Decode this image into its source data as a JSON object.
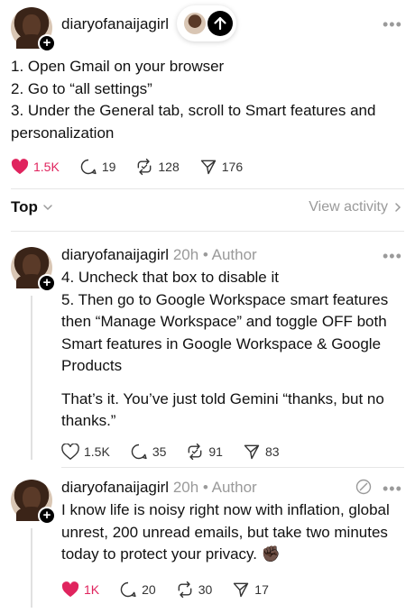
{
  "post1": {
    "username": "diaryofanaijagirl",
    "lines": [
      "1. Open Gmail on your browser",
      "2. Go to “all settings”",
      "3. Under the General tab, scroll to Smart features and personalization"
    ],
    "likes": "1.5K",
    "replies": "19",
    "reposts": "128",
    "shares": "176"
  },
  "sort": {
    "label": "Top",
    "view_activity": "View activity"
  },
  "reply1": {
    "username": "diaryofanaijagirl",
    "meta": "20h • Author",
    "lines": [
      "4. Uncheck that box to disable it",
      "5. Then go to Google Workspace smart features then “Manage Workspace” and toggle OFF both Smart features in Google Workspace & Google Products"
    ],
    "closing": "That’s it. You’ve just told Gemini “thanks, but no thanks.”",
    "likes": "1.5K",
    "replies": "35",
    "reposts": "91",
    "shares": "83"
  },
  "reply2": {
    "username": "diaryofanaijagirl",
    "meta": "20h • Author",
    "text": "I know life is noisy right now with inflation, global unrest, 200 unread emails, but take two minutes today to protect your privacy. ✊🏿",
    "likes": "1K",
    "replies": "20",
    "reposts": "30",
    "shares": "17"
  },
  "colors": {
    "like_red": "#e0245e",
    "muted": "#9a9a9a"
  },
  "icons": [
    "heart-icon",
    "reply-icon",
    "repost-icon",
    "share-icon",
    "more-icon",
    "follow-arrow-icon",
    "chevron-down-icon",
    "chevron-right-icon",
    "quote-icon"
  ]
}
